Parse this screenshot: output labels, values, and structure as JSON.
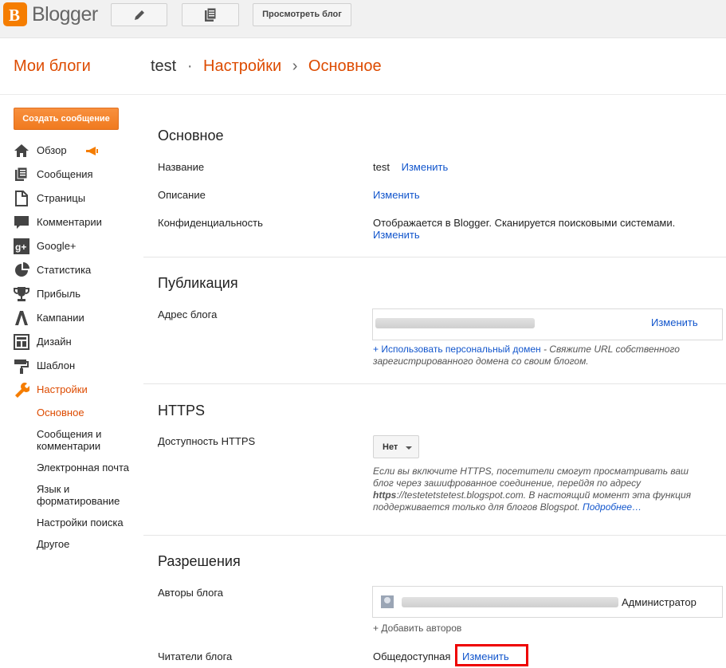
{
  "topbar": {
    "logo_letter": "B",
    "logo_text": "Blogger",
    "view_blog": "Просмотреть блог"
  },
  "header": {
    "my_blogs": "Мои блоги",
    "blog_name": "test",
    "dot": "·",
    "settings": "Настройки",
    "arrow": "›",
    "current": "Основное"
  },
  "sidebar": {
    "create_post": "Создать сообщение",
    "items": [
      {
        "label": "Обзор",
        "icon": "home-icon"
      },
      {
        "label": "Сообщения",
        "icon": "posts-icon"
      },
      {
        "label": "Страницы",
        "icon": "pages-icon"
      },
      {
        "label": "Комментарии",
        "icon": "comment-icon"
      },
      {
        "label": "Google+",
        "icon": "google-plus-icon"
      },
      {
        "label": "Статистика",
        "icon": "pie-chart-icon"
      },
      {
        "label": "Прибыль",
        "icon": "trophy-icon"
      },
      {
        "label": "Кампании",
        "icon": "adwords-icon"
      },
      {
        "label": "Дизайн",
        "icon": "layout-icon"
      },
      {
        "label": "Шаблон",
        "icon": "paint-roller-icon"
      },
      {
        "label": "Настройки",
        "icon": "wrench-icon"
      }
    ],
    "sub_items": [
      "Основное",
      "Сообщения и комментарии",
      "Электронная почта",
      "Язык и форматирование",
      "Настройки поиска",
      "Другое"
    ]
  },
  "basic": {
    "title": "Основное",
    "name_label": "Название",
    "name_value": "test",
    "change": "Изменить",
    "description_label": "Описание",
    "privacy_label": "Конфиденциальность",
    "privacy_value": "Отображается в Blogger. Сканируется поисковыми системами."
  },
  "publishing": {
    "title": "Публикация",
    "address_label": "Адрес блога",
    "change": "Изменить",
    "custom_domain_link": "+ Использовать персональный домен",
    "custom_domain_text": " - Свяжите URL собственного зарегистрированного домена со своим блогом."
  },
  "https": {
    "title": "HTTPS",
    "availability_label": "Доступность HTTPS",
    "selected": "Нет",
    "help_1": "Если вы включите HTTPS, посетители смогут просматривать ваш блог через зашифрованное соединение, перейдя по адресу ",
    "help_bold": "https",
    "help_2": "://testetetstetest.blogspot.com. В настоящий момент эта функция поддерживается только для блогов Blogspot. ",
    "more": "Подробнее…"
  },
  "permissions": {
    "title": "Разрешения",
    "authors_label": "Авторы блога",
    "role": "Администратор",
    "add_authors": "+ Добавить авторов",
    "readers_label": "Читатели блога",
    "readers_value": "Общедоступная",
    "change": "Изменить"
  },
  "colors": {
    "accent": "#dd4b00",
    "link": "#1155cc",
    "highlight": "#ee0000"
  }
}
